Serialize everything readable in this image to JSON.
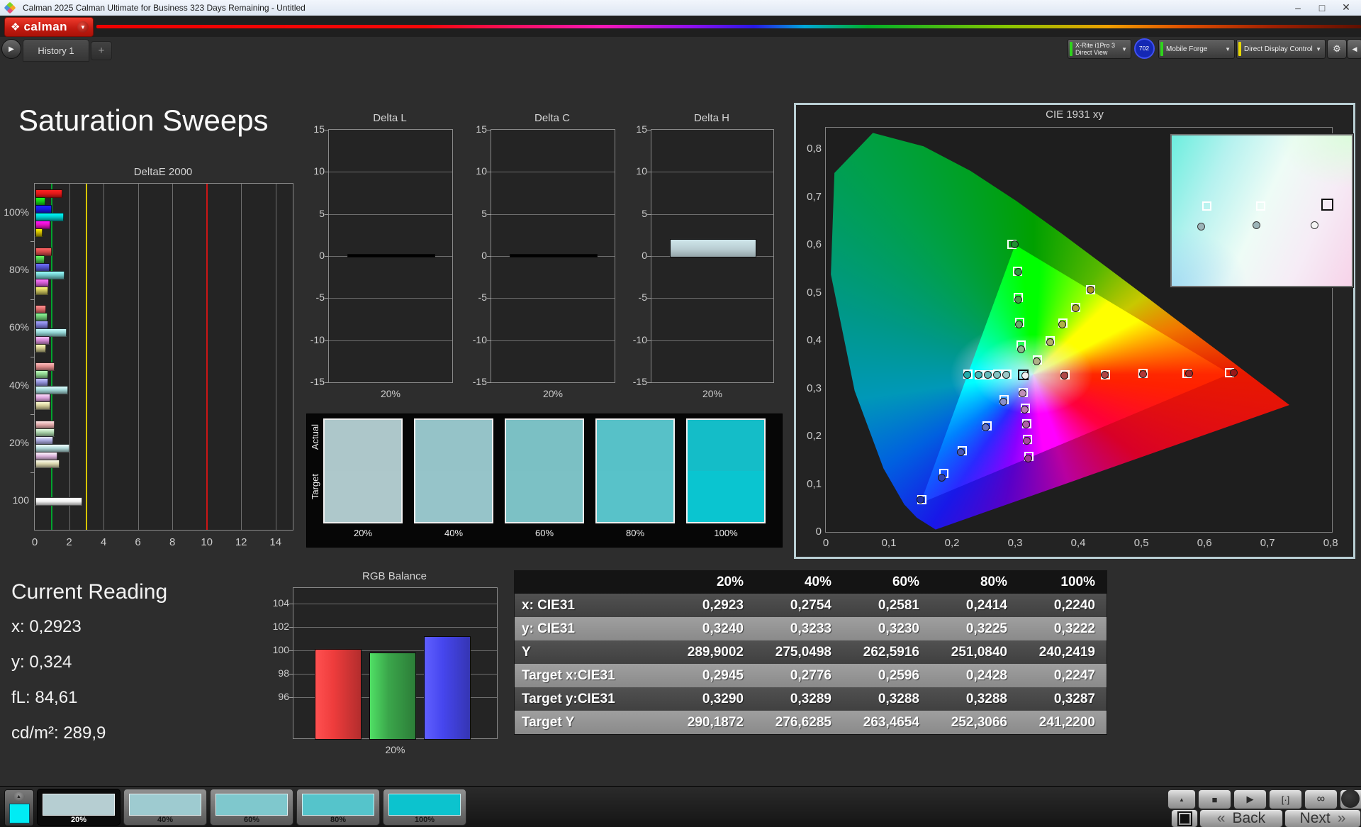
{
  "window": {
    "title": "Calman 2025 Calman Ultimate for Business 323 Days Remaining  - Untitled",
    "controls": {
      "minimize": "–",
      "maximize": "□",
      "close": "✕"
    }
  },
  "header": {
    "logo_glyph": "❖",
    "logo_text": "calman",
    "caret": "▼",
    "tab_arrow": "▶",
    "tab": "History 1",
    "add_tab": "+",
    "meter_button": {
      "line1": "X-Rite i1Pro 3",
      "line2": "Direct View",
      "stripe_color": "#2fd41c"
    },
    "meter_badge": "702",
    "source_button": {
      "label": "Mobile Forge",
      "stripe_color": "#2fd41c"
    },
    "display_button": {
      "label": "Direct Display Control",
      "stripe_color": "#e8d800"
    },
    "gear_glyph": "⚙",
    "collapse_glyph": "◀"
  },
  "page": {
    "title": "Saturation Sweeps"
  },
  "current_reading": {
    "title": "Current Reading",
    "lines": [
      "x: 0,2923",
      "y: 0,324",
      "fL: 84,61",
      "cd/m²: 289,9"
    ]
  },
  "sweep_swatches": {
    "row_labels": [
      "Actual",
      "Target"
    ],
    "items": [
      {
        "label": "20%",
        "actual": "#adc7ca",
        "target": "#aec8cb"
      },
      {
        "label": "40%",
        "actual": "#95c3c8",
        "target": "#96c4c9"
      },
      {
        "label": "60%",
        "actual": "#7bc0c4",
        "target": "#7cc1c5"
      },
      {
        "label": "80%",
        "actual": "#57c1c8",
        "target": "#58c2c9"
      },
      {
        "label": "100%",
        "actual": "#14bdc8",
        "target": "#0ac5d0"
      }
    ]
  },
  "footer": {
    "back_label": "Back",
    "next_label": "Next",
    "back_arrow": "«",
    "next_arrow": "»",
    "icon_glyphs": {
      "up": "▲",
      "stop": "■",
      "play": "▶",
      "bracket": "[·]",
      "loop": "∞",
      "refresh": "⟳"
    },
    "swatches": [
      {
        "label": "20%",
        "color": "#b6ced2",
        "selected": true
      },
      {
        "label": "40%",
        "color": "#9ecbd0",
        "selected": false
      },
      {
        "label": "60%",
        "color": "#7fc8cd",
        "selected": false
      },
      {
        "label": "80%",
        "color": "#55c4cb",
        "selected": false
      },
      {
        "label": "100%",
        "color": "#0cc3ce",
        "selected": false
      }
    ]
  },
  "chart_data": [
    {
      "type": "bar",
      "orientation": "horizontal",
      "title": "DeltaE 2000",
      "xlim": [
        0,
        15
      ],
      "xticks": [
        0,
        2,
        4,
        6,
        8,
        10,
        12,
        14
      ],
      "reference_lines": [
        {
          "value": 1,
          "color": "#00a32e"
        },
        {
          "value": 3,
          "color": "#d6c400"
        },
        {
          "value": 10,
          "color": "#cc1616"
        }
      ],
      "groups": [
        {
          "label": "100%",
          "values": [
            1.5,
            0.5,
            0.85,
            1.55,
            0.8,
            0.35
          ],
          "colors": [
            "#e01818",
            "#14c814",
            "#1818e0",
            "#00c8c8",
            "#e010c0",
            "#c8b400"
          ]
        },
        {
          "label": "80%",
          "values": [
            0.85,
            0.45,
            0.75,
            1.6,
            0.7,
            0.65
          ],
          "colors": [
            "#d04848",
            "#48b848",
            "#5050c8",
            "#70c8c8",
            "#cc58cc",
            "#c4bc58"
          ]
        },
        {
          "label": "60%",
          "values": [
            0.55,
            0.6,
            0.65,
            1.75,
            0.75,
            0.55
          ],
          "colors": [
            "#d86868",
            "#68c070",
            "#7878d0",
            "#90d0d0",
            "#d088d0",
            "#ccc488"
          ]
        },
        {
          "label": "40%",
          "values": [
            1.05,
            0.65,
            0.65,
            1.8,
            0.8,
            0.8
          ],
          "colors": [
            "#dc8888",
            "#88cc88",
            "#9090d8",
            "#a0d4d4",
            "#d8a0d8",
            "#d4cc98"
          ]
        },
        {
          "label": "20%",
          "values": [
            1.05,
            1.05,
            0.95,
            1.9,
            1.2,
            1.3
          ],
          "colors": [
            "#dca4a4",
            "#a4cca4",
            "#a8a8dc",
            "#b0d8d8",
            "#dcb4dc",
            "#d8d4ac"
          ]
        },
        {
          "label": "100",
          "values": [
            2.65
          ],
          "colors": [
            "#f2f2f2"
          ]
        }
      ]
    },
    {
      "type": "bar",
      "title": "Delta L",
      "ylim": [
        -15,
        15
      ],
      "yticks": [
        15,
        10,
        5,
        0,
        -5,
        -10,
        -15
      ],
      "categories": [
        "20%"
      ],
      "values": [
        0.0
      ],
      "bar_color": "#b9cdd2"
    },
    {
      "type": "bar",
      "title": "Delta C",
      "ylim": [
        -15,
        15
      ],
      "yticks": [
        15,
        10,
        5,
        0,
        -5,
        -10,
        -15
      ],
      "categories": [
        "20%"
      ],
      "values": [
        0.0
      ],
      "bar_color": "#b9cdd2"
    },
    {
      "type": "bar",
      "title": "Delta H",
      "ylim": [
        -15,
        15
      ],
      "yticks": [
        15,
        10,
        5,
        0,
        -5,
        -10,
        -15
      ],
      "categories": [
        "20%"
      ],
      "values": [
        2.0
      ],
      "bar_color": "#b9cdd2"
    },
    {
      "type": "scatter",
      "title": "CIE 1931 xy",
      "xlim": [
        0,
        0.8
      ],
      "ylim": [
        0,
        0.8
      ],
      "xticks": [
        0,
        0.1,
        0.2,
        0.3,
        0.4,
        0.5,
        0.6,
        0.7,
        0.8
      ],
      "xtick_labels": [
        "0",
        "0,1",
        "0,2",
        "0,3",
        "0,4",
        "0,5",
        "0,6",
        "0,7",
        "0,8"
      ],
      "yticks": [
        0,
        0.1,
        0.2,
        0.3,
        0.4,
        0.5,
        0.6,
        0.7,
        0.8
      ],
      "ytick_labels": [
        "0",
        "0,1",
        "0,2",
        "0,3",
        "0,4",
        "0,5",
        "0,6",
        "0,7",
        "0,8"
      ],
      "gamut_triangle": [
        [
          0.64,
          0.33
        ],
        [
          0.3,
          0.6
        ],
        [
          0.15,
          0.06
        ]
      ],
      "white_target": [
        0.313,
        0.329
      ],
      "targets": [
        [
          0.379,
          0.328
        ],
        [
          0.443,
          0.329
        ],
        [
          0.503,
          0.331
        ],
        [
          0.572,
          0.332
        ],
        [
          0.64,
          0.333
        ],
        [
          0.31,
          0.39
        ],
        [
          0.307,
          0.438
        ],
        [
          0.305,
          0.49
        ],
        [
          0.304,
          0.545
        ],
        [
          0.295,
          0.601
        ],
        [
          0.335,
          0.36
        ],
        [
          0.356,
          0.399
        ],
        [
          0.376,
          0.436
        ],
        [
          0.396,
          0.469
        ],
        [
          0.42,
          0.507
        ],
        [
          0.287,
          0.33
        ],
        [
          0.272,
          0.33
        ],
        [
          0.258,
          0.329
        ],
        [
          0.243,
          0.329
        ],
        [
          0.225,
          0.33
        ],
        [
          0.283,
          0.276
        ],
        [
          0.256,
          0.222
        ],
        [
          0.216,
          0.17
        ],
        [
          0.187,
          0.122
        ],
        [
          0.152,
          0.068
        ],
        [
          0.313,
          0.292
        ],
        [
          0.316,
          0.259
        ],
        [
          0.318,
          0.226
        ],
        [
          0.32,
          0.193
        ],
        [
          0.322,
          0.158
        ]
      ],
      "measurements": [
        [
          0.378,
          0.327,
          "#b04848"
        ],
        [
          0.442,
          0.329,
          "#b04444"
        ],
        [
          0.503,
          0.33,
          "#b03838"
        ],
        [
          0.576,
          0.332,
          "#a02828"
        ],
        [
          0.646,
          0.333,
          "#981818"
        ],
        [
          0.309,
          0.381,
          "#88b888"
        ],
        [
          0.306,
          0.433,
          "#68aa68"
        ],
        [
          0.305,
          0.485,
          "#48a048"
        ],
        [
          0.305,
          0.543,
          "#2f9a3f"
        ],
        [
          0.299,
          0.601,
          "#1f8f2f"
        ],
        [
          0.334,
          0.356,
          "#b0b088"
        ],
        [
          0.355,
          0.396,
          "#b0b068"
        ],
        [
          0.375,
          0.433,
          "#b0b048"
        ],
        [
          0.396,
          0.467,
          "#b0a830"
        ],
        [
          0.419,
          0.506,
          "#a89820"
        ],
        [
          0.286,
          0.328,
          "#9cc8c8"
        ],
        [
          0.271,
          0.328,
          "#84c4c4"
        ],
        [
          0.257,
          0.328,
          "#64bcbc"
        ],
        [
          0.242,
          0.328,
          "#44b4b4"
        ],
        [
          0.224,
          0.329,
          "#24acac"
        ],
        [
          0.281,
          0.272,
          "#8890c8"
        ],
        [
          0.253,
          0.218,
          "#6874c0"
        ],
        [
          0.214,
          0.167,
          "#4858b8"
        ],
        [
          0.184,
          0.114,
          "#3040b0"
        ],
        [
          0.15,
          0.067,
          "#2030a8"
        ],
        [
          0.312,
          0.29,
          "#c090b8"
        ],
        [
          0.315,
          0.256,
          "#b878b0"
        ],
        [
          0.317,
          0.224,
          "#b060a8"
        ],
        [
          0.319,
          0.191,
          "#a848a0"
        ],
        [
          0.321,
          0.154,
          "#a03898"
        ],
        [
          0.316,
          0.327,
          "#f0f0f0"
        ]
      ],
      "inset": {
        "targets": [
          {
            "x": 17,
            "y": 44,
            "style": "white"
          },
          {
            "x": 47,
            "y": 44,
            "style": "white"
          },
          {
            "x": 83,
            "y": 42,
            "style": "black"
          }
        ],
        "points": [
          {
            "x": 14,
            "y": 58,
            "color": "#9cb4b8"
          },
          {
            "x": 45,
            "y": 57,
            "color": "#9cb4b8"
          },
          {
            "x": 77,
            "y": 57,
            "color": "#f4f4f4"
          }
        ]
      }
    },
    {
      "type": "bar",
      "title": "RGB Balance",
      "ylim": [
        92.5,
        105.3
      ],
      "yticks": [
        104,
        102,
        100,
        98,
        96
      ],
      "categories": [
        "Red",
        "Green",
        "Blue"
      ],
      "values": [
        100.1,
        99.8,
        101.2
      ],
      "colors": [
        "#ee3c3c",
        "#3ba64b",
        "#4646ee"
      ],
      "xlabel": "20%"
    },
    {
      "type": "table",
      "columns": [
        "",
        "20%",
        "40%",
        "60%",
        "80%",
        "100%"
      ],
      "rows": [
        {
          "label": "x: CIE31",
          "values": [
            "0,2923",
            "0,2754",
            "0,2581",
            "0,2414",
            "0,2240"
          ]
        },
        {
          "label": "y: CIE31",
          "values": [
            "0,3240",
            "0,3233",
            "0,3230",
            "0,3225",
            "0,3222"
          ]
        },
        {
          "label": "Y",
          "values": [
            "289,9002",
            "275,0498",
            "262,5916",
            "251,0840",
            "240,2419"
          ]
        },
        {
          "label": "Target x:CIE31",
          "values": [
            "0,2945",
            "0,2776",
            "0,2596",
            "0,2428",
            "0,2247"
          ]
        },
        {
          "label": "Target y:CIE31",
          "values": [
            "0,3290",
            "0,3289",
            "0,3288",
            "0,3288",
            "0,3287"
          ]
        },
        {
          "label": "Target Y",
          "values": [
            "290,1872",
            "276,6285",
            "263,4654",
            "252,3066",
            "241,2200"
          ]
        }
      ]
    }
  ]
}
